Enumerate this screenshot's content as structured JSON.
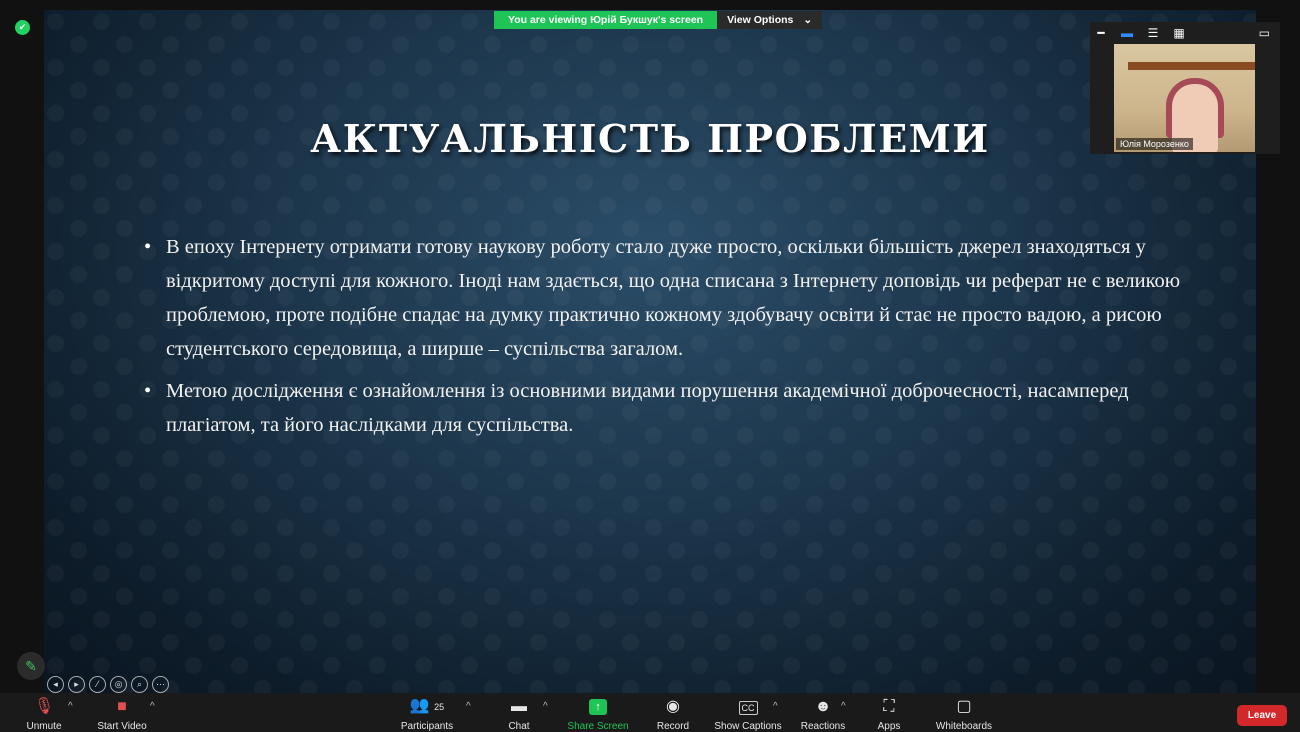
{
  "banner": {
    "viewing_text": "You are viewing Юрій Букшук's screen",
    "view_options": "View Options",
    "view_options_caret": "⌄"
  },
  "slide": {
    "title": "АКТУАЛЬНІСТЬ ПРОБЛЕМИ",
    "bullets": [
      "В епоху Інтернету отримати готову наукову роботу стало дуже просто, оскільки більшість джерел знаходяться у відкритому доступі для кожного. Іноді нам здається, що одна списана з Інтернету доповідь чи реферат не є великою проблемою, проте подібне спадає на думку практично кожному здобувачу освіти й стає не просто вадою, а рисою студентського середовища, а ширше – суспільства загалом.",
      "Метою дослідження є ознайомлення із основними видами порушення академічної доброчесності, насамперед плагіатом, та його наслідками для суспільства."
    ]
  },
  "video_panel": {
    "participant_name": "Юлія Морозенко",
    "icons": [
      "minimize-icon",
      "speaker-view-icon",
      "gallery-strip-icon",
      "grid-icon",
      "pop-out-icon"
    ]
  },
  "toolbar": {
    "unmute_label": "Unmute",
    "start_video_label": "Start Video",
    "participants_label": "Participants",
    "participants_count": "25",
    "chat_label": "Chat",
    "share_screen_label": "Share Screen",
    "record_label": "Record",
    "show_captions_label": "Show Captions",
    "reactions_label": "Reactions",
    "apps_label": "Apps",
    "whiteboards_label": "Whiteboards",
    "leave_label": "Leave"
  },
  "colors": {
    "share_green": "#1fc456",
    "leave_red": "#d2282a",
    "active_blue": "#2d8cff"
  }
}
